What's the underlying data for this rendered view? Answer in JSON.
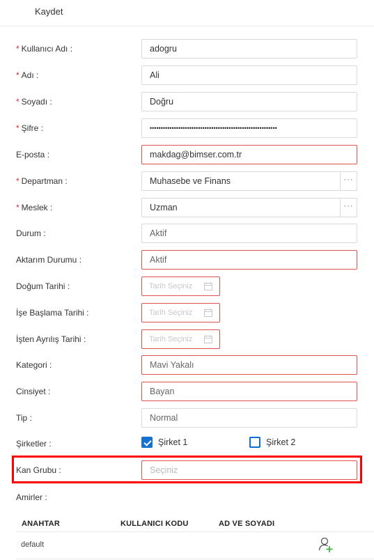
{
  "toolbar": {
    "save_label": "Kaydet"
  },
  "form": {
    "username": {
      "label": "Kullanıcı Adı",
      "required": true,
      "value": "adogru"
    },
    "first_name": {
      "label": "Adı",
      "required": true,
      "value": "Ali"
    },
    "last_name": {
      "label": "Soyadı",
      "required": true,
      "value": "Doğru"
    },
    "password": {
      "label": "Şifre",
      "required": true,
      "value": "••••••••••••••••••••••••••••••••••••••••••••••••••••••••••"
    },
    "email": {
      "label": "E-posta",
      "required": false,
      "value": "makdag@bimser.com.tr"
    },
    "department": {
      "label": "Departman",
      "required": true,
      "value": "Muhasebe ve Finans",
      "button": "···"
    },
    "profession": {
      "label": "Meslek",
      "required": true,
      "value": "Uzman",
      "button": "···"
    },
    "status": {
      "label": "Durum",
      "value": "Aktif"
    },
    "transfer_status": {
      "label": "Aktarım Durumu",
      "value": "Aktif"
    },
    "birth_date": {
      "label": "Doğum Tarihi",
      "placeholder": "Tarih Seçiniz"
    },
    "start_date": {
      "label": "İşe Başlama Tarihi",
      "placeholder": "Tarih Seçiniz"
    },
    "leave_date": {
      "label": "İşten Ayrılış Tarihi",
      "placeholder": "Tarih Seçiniz"
    },
    "category": {
      "label": "Kategori",
      "value": "Mavi Yakalı"
    },
    "gender": {
      "label": "Cinsiyet",
      "value": "Bayan"
    },
    "type": {
      "label": "Tip",
      "value": "Normal"
    },
    "companies": {
      "label": "Şirketler",
      "options": [
        {
          "label": "Şirket 1",
          "checked": true
        },
        {
          "label": "Şirket 2",
          "checked": false
        }
      ]
    },
    "blood_group": {
      "label": "Kan Grubu",
      "placeholder": "Seçiniz"
    },
    "colon": ":"
  },
  "supervisors": {
    "label": "Amirler",
    "columns": [
      "ANAHTAR",
      "KULLANICI KODU",
      "AD VE SOYADI"
    ],
    "rows": [
      {
        "key": "default",
        "user_code": "",
        "full_name": ""
      }
    ],
    "add_icon": "add-user-icon"
  },
  "colors": {
    "required": "#e0282e",
    "error_border": "#e05252",
    "highlight": "#ff0000",
    "checkbox": "#1570d1",
    "add_plus": "#2eaa3a"
  }
}
